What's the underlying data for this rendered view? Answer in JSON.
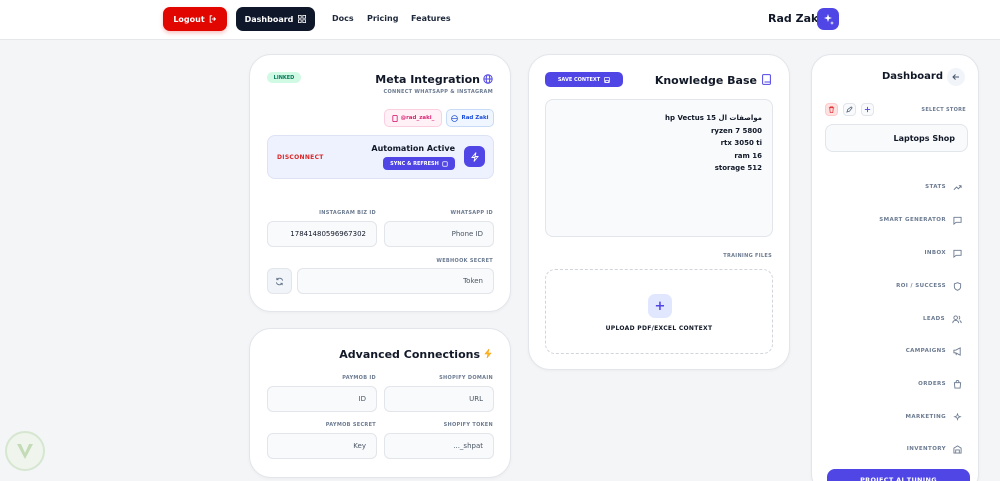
{
  "header": {
    "logout_label": "Logout",
    "dashboard_label": "Dashboard",
    "nav": [
      "Docs",
      "Pricing",
      "Features"
    ],
    "brand": "Rad Zaki"
  },
  "meta": {
    "status_badge": "LINKED",
    "title": "Meta Integration",
    "subtitle": "CONNECT WHATSAPP & INSTAGRAM",
    "instagram_handle": "@rad_zaki_",
    "facebook_name": "Rad Zaki",
    "disconnect_label": "DISCONNECT",
    "automation_title": "Automation Active",
    "sync_label": "SYNC & REFRESH",
    "instagram_id_label": "INSTAGRAM BIZ ID",
    "instagram_id_value": "17841480596967302",
    "whatsapp_id_label": "WHATSAPP ID",
    "whatsapp_id_placeholder": "Phone ID",
    "webhook_label": "WEBHOOK SECRET",
    "webhook_placeholder": "Token"
  },
  "advanced": {
    "title": "Advanced Connections",
    "paymob_id_label": "PAYMOB ID",
    "paymob_id_placeholder": "ID",
    "shopify_domain_label": "SHOPIFY DOMAIN",
    "shopify_domain_placeholder": "URL",
    "paymob_secret_label": "PAYMOB SECRET",
    "paymob_secret_placeholder": "Key",
    "shopify_token_label": "SHOPIFY TOKEN",
    "shopify_token_placeholder": "..._shpat"
  },
  "knowledge": {
    "save_label": "SAVE CONTEXT",
    "title": "Knowledge Base",
    "content_lines": [
      "مواصفات ال hp Vectus 15",
      "ryzen 7 5800",
      "rtx 3050 ti",
      "ram 16",
      "storage 512"
    ],
    "training_label": "TRAINING FILES",
    "upload_label": "UPLOAD PDF/EXCEL CONTEXT"
  },
  "sidebar": {
    "title": "Dashboard",
    "select_store_label": "SELECT STORE",
    "store_name": "Laptops Shop",
    "items": [
      {
        "label": "STATS",
        "icon": "trending-up-icon"
      },
      {
        "label": "SMART GENERATOR",
        "icon": "message-square-icon"
      },
      {
        "label": "INBOX",
        "icon": "chat-icon"
      },
      {
        "label": "ROI / SUCCESS",
        "icon": "shield-icon"
      },
      {
        "label": "LEADS",
        "icon": "users-icon"
      },
      {
        "label": "CAMPAIGNS",
        "icon": "megaphone-icon"
      },
      {
        "label": "ORDERS",
        "icon": "shopping-bag-icon"
      },
      {
        "label": "MARKETING",
        "icon": "sparkles-icon"
      },
      {
        "label": "INVENTORY",
        "icon": "warehouse-icon"
      }
    ],
    "cta_label": "PROJECT AI TUNING"
  },
  "colors": {
    "accent": "#4f46e5",
    "danger": "#e10600",
    "dark": "#0f172a",
    "success_bg": "#d1fae5"
  }
}
